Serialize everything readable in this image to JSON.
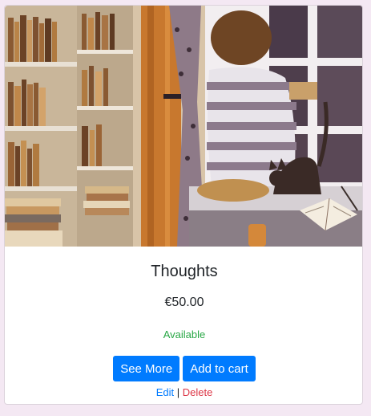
{
  "product": {
    "title": "Thoughts",
    "price": "€50.00",
    "availability": "Available",
    "image_icon": "watercolor-illustration-reader-window-cat"
  },
  "actions": {
    "see_more_label": "See More",
    "add_to_cart_label": "Add to cart",
    "edit_label": "Edit",
    "separator": "|",
    "delete_label": "Delete"
  },
  "colors": {
    "page_background": "#f4e8f3",
    "primary": "#007bff",
    "success": "#28a745",
    "danger": "#dc3545"
  }
}
